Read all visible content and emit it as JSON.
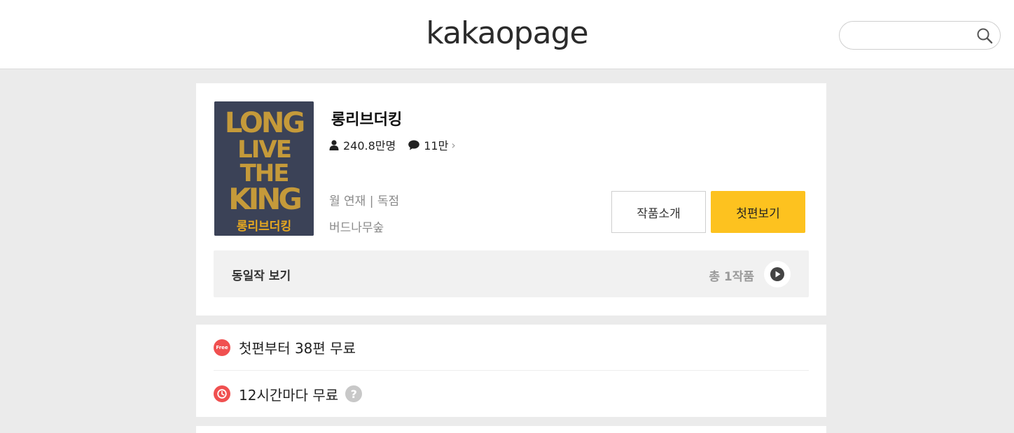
{
  "header": {
    "logo": "kakaopage",
    "search": {
      "value": "",
      "placeholder": ""
    }
  },
  "work": {
    "title": "롱리브더킹",
    "cover_text": [
      "LONG",
      "LIVE",
      "THE",
      "KING"
    ],
    "cover_subtitle": "롱리브더킹",
    "views": "240.8만명",
    "comments": "11만",
    "schedule": "월 연재 | 독점",
    "author": "버드나무숲",
    "buttons": {
      "intro": "작품소개",
      "first": "첫편보기"
    }
  },
  "same_works": {
    "label": "동일작 보기",
    "count": "총 1작품"
  },
  "free_info": {
    "badge": "Free",
    "row1": "첫편부터 38편 무료",
    "row2": "12시간마다 무료"
  },
  "colors": {
    "accent": "#fdc21f",
    "free_badge": "#f05050"
  }
}
